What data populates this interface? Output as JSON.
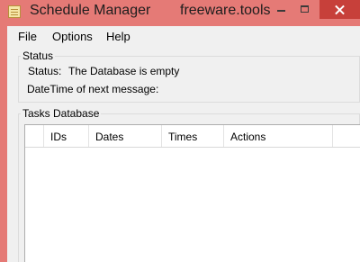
{
  "window": {
    "title": "Schedule Manager",
    "watermark": "freeware.tools"
  },
  "menu": {
    "file": "File",
    "options": "Options",
    "help": "Help"
  },
  "status_group": {
    "label": "Status",
    "status_label": "Status:",
    "status_value": "The Database is empty",
    "next_message_label": "DateTime of next message:"
  },
  "tasks_group": {
    "label": "Tasks Database",
    "columns": [
      "IDs",
      "Dates",
      "Times",
      "Actions"
    ],
    "rows": []
  },
  "colors": {
    "frame": "#e57a76",
    "close_button": "#c7403a",
    "client": "#f0f0f0"
  }
}
